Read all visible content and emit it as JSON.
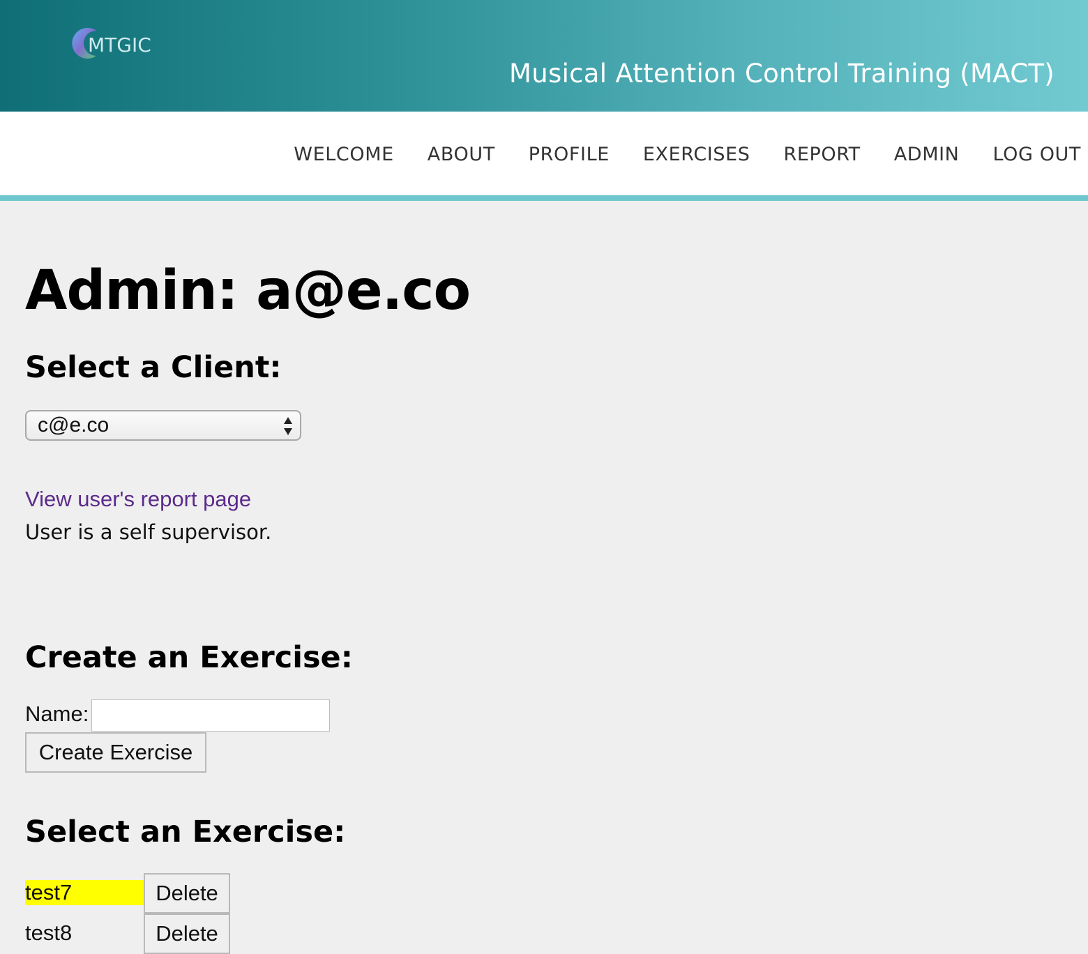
{
  "header": {
    "logo_text": "MTGIC",
    "site_title": "Musical Attention Control Training (MACT)"
  },
  "nav": {
    "items": [
      "WELCOME",
      "ABOUT",
      "PROFILE",
      "EXERCISES",
      "REPORT",
      "ADMIN",
      "LOG OUT"
    ]
  },
  "main": {
    "title": "Admin: a@e.co",
    "select_client_heading": "Select a Client:",
    "client_select_value": "c@e.co",
    "report_link": "View user's report page",
    "supervisor_status": "User is a self supervisor.",
    "create_exercise_heading": "Create an Exercise:",
    "name_label": "Name:",
    "name_input_value": "",
    "create_button": "Create Exercise",
    "select_exercise_heading": "Select an Exercise:",
    "exercises": [
      {
        "name": "test7",
        "delete_label": "Delete",
        "highlighted": true
      },
      {
        "name": "test8",
        "delete_label": "Delete",
        "highlighted": false
      }
    ]
  },
  "colors": {
    "banner_start": "#0f6e76",
    "banner_end": "#72cad1",
    "nav_border": "#6fc7cf",
    "link": "#5b2a8c",
    "highlight": "#ffff00",
    "page_bg": "#efefef"
  }
}
